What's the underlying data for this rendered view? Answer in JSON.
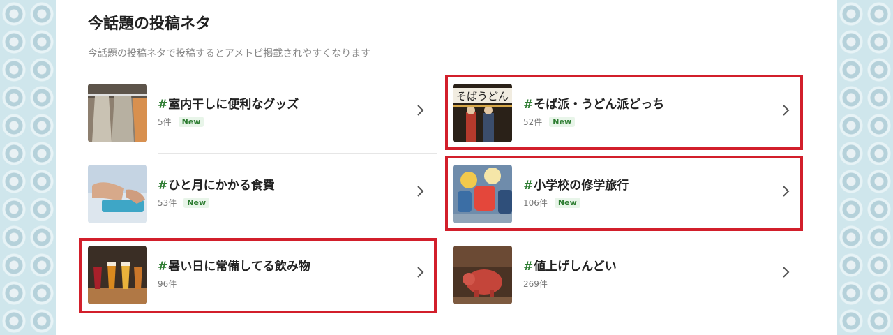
{
  "section": {
    "title": "今話題の投稿ネタ",
    "subtitle": "今話題の投稿ネタで投稿するとアメトピ掲載されやすくなります"
  },
  "topics": [
    {
      "tag": "室内干しに便利なグッズ",
      "count": "5件",
      "badge": "New",
      "thumbnail": "hanging-clothes-image"
    },
    {
      "tag": "そば派・うどん派どっち",
      "count": "52件",
      "badge": "New",
      "thumbnail": "udon-shop-image",
      "highlighted": true
    },
    {
      "tag": "ひと月にかかる食費",
      "count": "53件",
      "badge": "New",
      "thumbnail": "calculator-image"
    },
    {
      "tag": "小学校の修学旅行",
      "count": "106件",
      "badge": "New",
      "thumbnail": "school-trip-image",
      "highlighted": true
    },
    {
      "tag": "暑い日に常備してる飲み物",
      "count": "96件",
      "thumbnail": "beer-flight-image",
      "highlighted": true
    },
    {
      "tag": "値上げしんどい",
      "count": "269件",
      "thumbnail": "piggy-bank-image"
    }
  ],
  "hash_symbol": "#",
  "colors": {
    "hash": "#2e7d32",
    "highlight": "#d21f2b",
    "badge_bg": "#e8f5e9"
  },
  "icons": {
    "chevron": "chevron-right-icon"
  }
}
